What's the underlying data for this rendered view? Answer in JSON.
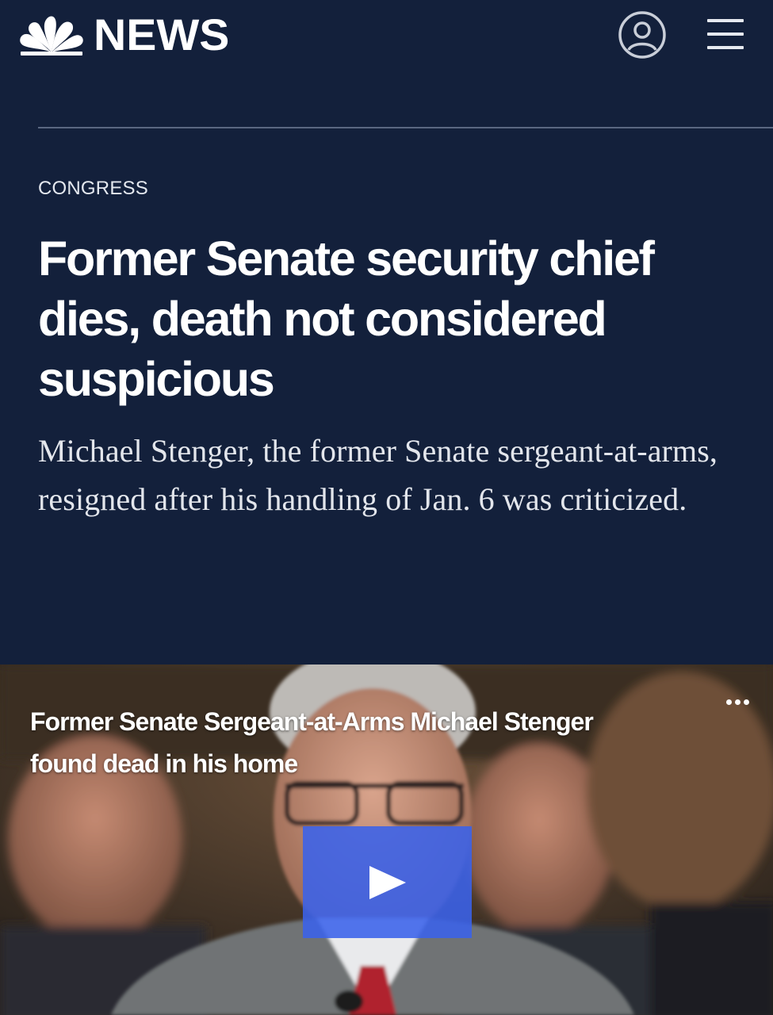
{
  "header": {
    "logo_text": "NEWS",
    "logo_icon": "peacock-icon",
    "profile_icon": "user-profile-icon",
    "menu_icon": "hamburger-menu-icon"
  },
  "article": {
    "section": "CONGRESS",
    "headline": "Former Senate security chief dies, death not considered suspicious",
    "dek": "Michael Stenger, the former Senate sergeant-at-arms, resigned after his handling of Jan. 6 was criticized."
  },
  "video": {
    "title": "Former Senate Sergeant-at-Arms Michael Stenger found dead in his home",
    "more_icon": "more-options-icon",
    "play_icon": "play-icon"
  },
  "colors": {
    "background": "#13203b",
    "text": "#ffffff",
    "play_button": "#3a62eb",
    "divider": "#5a6781"
  }
}
